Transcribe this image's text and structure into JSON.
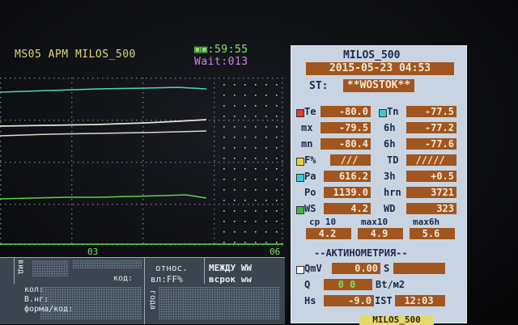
{
  "header": {
    "title": "MS05 APM MILOS_500",
    "clock": "▣▣:59:55",
    "wait": "Wait:013"
  },
  "plot": {
    "axis_labels": [
      "03",
      "06"
    ],
    "colors": {
      "cyan": "#4fd8b4",
      "white": "#e4e6d6",
      "green": "#5cd24a",
      "grid": "#6f7f8e"
    }
  },
  "table": {
    "headers": {
      "vid": "вид",
      "kod": "код:",
      "otnos": "относ.",
      "vl": "вл:FF%",
      "mezhdu": "МЕЖДУ WW",
      "vsrok": "всрок ww"
    },
    "rows": {
      "kol": "кол:",
      "vng": "В.нг:",
      "forma": "форма/код:",
      "goda": "года"
    }
  },
  "panel": {
    "title": "MILOS_500",
    "datetime": "2015-05-23 04:53",
    "st_label": "ST:",
    "station": "**WOSTOK**",
    "te_label": "Te",
    "te_value": "-80.0",
    "tn_label": "Tn",
    "tn_value": "-77.5",
    "mx_label": "mx",
    "mx_value": "-79.5",
    "h6a_label": "6h",
    "h6a_value": "-77.2",
    "mn_label": "mn",
    "mn_value": "-80.4",
    "h6b_label": "6h",
    "h6b_value": "-77.6",
    "f_label": "F%",
    "f_value": "///",
    "td_label": "TD",
    "td_value": "/////",
    "pa_label": "Pa",
    "pa_value": "616.2",
    "h3_label": "3h",
    "h3_value": "+0.5",
    "po_label": "Po",
    "po_value": "1139.0",
    "hrn_label": "hrn",
    "hrn_value": "3721",
    "ws_label": "WS",
    "ws_value": "4.2",
    "wd_label": "WD",
    "wd_value": "323",
    "cp10_label": "cp 10",
    "max10_label": "max10",
    "max6h_label": "max6h",
    "cp10_value": "4.2",
    "max10_value": "4.9",
    "max6h_value": "5.6",
    "aktino_title": "--АКТИНОМЕТРИЯ--",
    "qmv_label": "QmV",
    "qmv_value": "0.00",
    "s_label": "S",
    "s_value": "",
    "q_label": "Q",
    "q_value": "0 0",
    "q_unit": "Bt/м2",
    "hs_label": "Hs",
    "hs_value": "-9.0",
    "ist_label": "IST",
    "ist_value": "12:03",
    "footer": "MILOS_500",
    "colors": {
      "red": "#e23a2a",
      "cyan": "#3ec8d8",
      "yellow": "#e6d23a",
      "green": "#3aba3a",
      "white": "#f4f4f4"
    }
  }
}
